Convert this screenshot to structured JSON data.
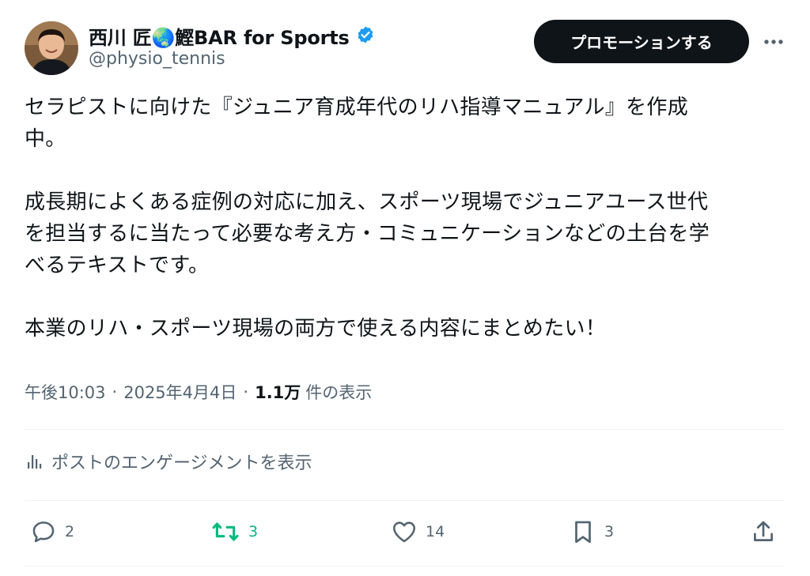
{
  "user": {
    "display_name": "西川 匠🌏鰹BAR for Sports",
    "handle": "@physio_tennis",
    "avatar_icon": "avatar",
    "verified_icon": "verified-badge-icon",
    "verified_color": "#1d9bf0"
  },
  "header": {
    "promote_label": "プロモーションする",
    "more_icon": "more-icon"
  },
  "tweet": {
    "lines": [
      "セラピストに向けた『ジュニア育成年代のリハ指導マニュアル』を作成",
      "中。",
      "成長期によくある症例の対応に加え、スポーツ現場でジュニアユース世代",
      "を担当するに当たって必要な考え方・コミュニケーションなどの土台を学",
      "べるテキストです。",
      "本業のリハ・スポーツ現場の両方で使える内容にまとめたい！"
    ]
  },
  "meta": {
    "time": "午後10:03",
    "date": "2025年4月4日",
    "separator": "·",
    "views_count": "1.1万",
    "views_label": "件の表示"
  },
  "engagement": {
    "label": "ポストのエンゲージメントを表示",
    "icon": "analytics-icon"
  },
  "actions": {
    "reply_count": "2",
    "retweet_count": "3",
    "like_count": "14",
    "bookmark_count": "3",
    "retweet_color": "#00ba7c",
    "muted_color": "#536471"
  }
}
